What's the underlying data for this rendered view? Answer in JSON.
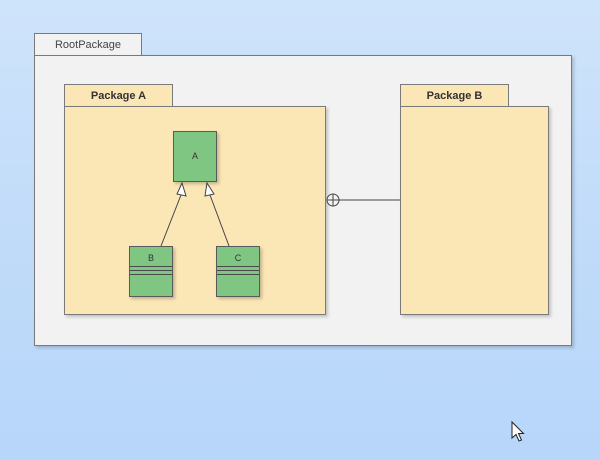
{
  "diagram": {
    "root_package": {
      "name": "RootPackage"
    },
    "packages": [
      {
        "name": "Package A"
      },
      {
        "name": "Package B"
      }
    ],
    "classes": [
      {
        "name": "A"
      },
      {
        "name": "B"
      },
      {
        "name": "C"
      }
    ],
    "relations": [
      {
        "type": "generalization",
        "from": "B",
        "to": "A"
      },
      {
        "type": "generalization",
        "from": "C",
        "to": "A"
      },
      {
        "type": "nesting",
        "from": "Package A",
        "to": "Package B"
      }
    ],
    "colors": {
      "background": "#c2dcf9",
      "root_fill": "#f2f2f2",
      "package_fill": "#fbe6b6",
      "class_fill": "#80c683"
    }
  }
}
